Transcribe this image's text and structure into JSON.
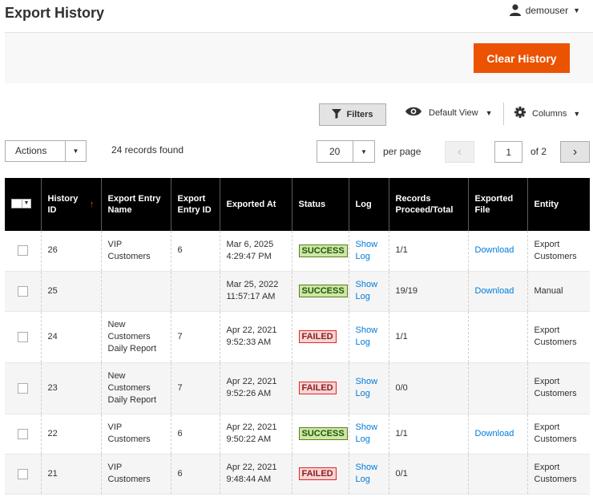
{
  "header": {
    "title": "Export History",
    "username": "demouser"
  },
  "action_bar": {
    "clear_label": "Clear History"
  },
  "toolbar": {
    "filters_label": "Filters",
    "view_label": "Default View",
    "columns_label": "Columns"
  },
  "grid_controls": {
    "actions_label": "Actions",
    "records_found": "24 records found",
    "per_page_value": "20",
    "per_page_label": "per page",
    "current_page": "1",
    "of_pages": "of 2"
  },
  "columns": {
    "history_id": "History ID",
    "entry_name": "Export Entry Name",
    "entry_id": "Export Entry ID",
    "exported_at": "Exported At",
    "status": "Status",
    "log": "Log",
    "records": "Records Proceed/Total",
    "file": "Exported File",
    "entity": "Entity"
  },
  "rows": [
    {
      "id": "26",
      "name": "VIP Customers",
      "entry_id": "6",
      "date": "Mar 6, 2025",
      "time": "4:29:47 PM",
      "status": "SUCCESS",
      "status_type": "success",
      "log1": "Show",
      "log2": "Log",
      "records": "1/1",
      "file": "Download",
      "entity": "Export Customers"
    },
    {
      "id": "25",
      "name": "",
      "entry_id": "",
      "date": "Mar 25, 2022",
      "time": "11:57:17 AM",
      "status": "SUCCESS",
      "status_type": "success",
      "log1": "Show",
      "log2": "Log",
      "records": "19/19",
      "file": "Download",
      "entity": "Manual"
    },
    {
      "id": "24",
      "name": "New Customers Daily Report",
      "entry_id": "7",
      "date": "Apr 22, 2021",
      "time": "9:52:33 AM",
      "status": "FAILED",
      "status_type": "failed",
      "log1": "Show",
      "log2": "Log",
      "records": "1/1",
      "file": "",
      "entity": "Export Customers"
    },
    {
      "id": "23",
      "name": "New Customers Daily Report",
      "entry_id": "7",
      "date": "Apr 22, 2021",
      "time": "9:52:26 AM",
      "status": "FAILED",
      "status_type": "failed",
      "log1": "Show",
      "log2": "Log",
      "records": "0/0",
      "file": "",
      "entity": "Export Customers"
    },
    {
      "id": "22",
      "name": "VIP Customers",
      "entry_id": "6",
      "date": "Apr 22, 2021",
      "time": "9:50:22 AM",
      "status": "SUCCESS",
      "status_type": "success",
      "log1": "Show",
      "log2": "Log",
      "records": "1/1",
      "file": "Download",
      "entity": "Export Customers"
    },
    {
      "id": "21",
      "name": "VIP Customers",
      "entry_id": "6",
      "date": "Apr 22, 2021",
      "time": "9:48:44 AM",
      "status": "FAILED",
      "status_type": "failed",
      "log1": "Show",
      "log2": "Log",
      "records": "0/1",
      "file": "",
      "entity": "Export Customers"
    }
  ],
  "colors": {
    "accent": "#eb5202",
    "link": "#007bdb",
    "header_bg": "#000000"
  }
}
